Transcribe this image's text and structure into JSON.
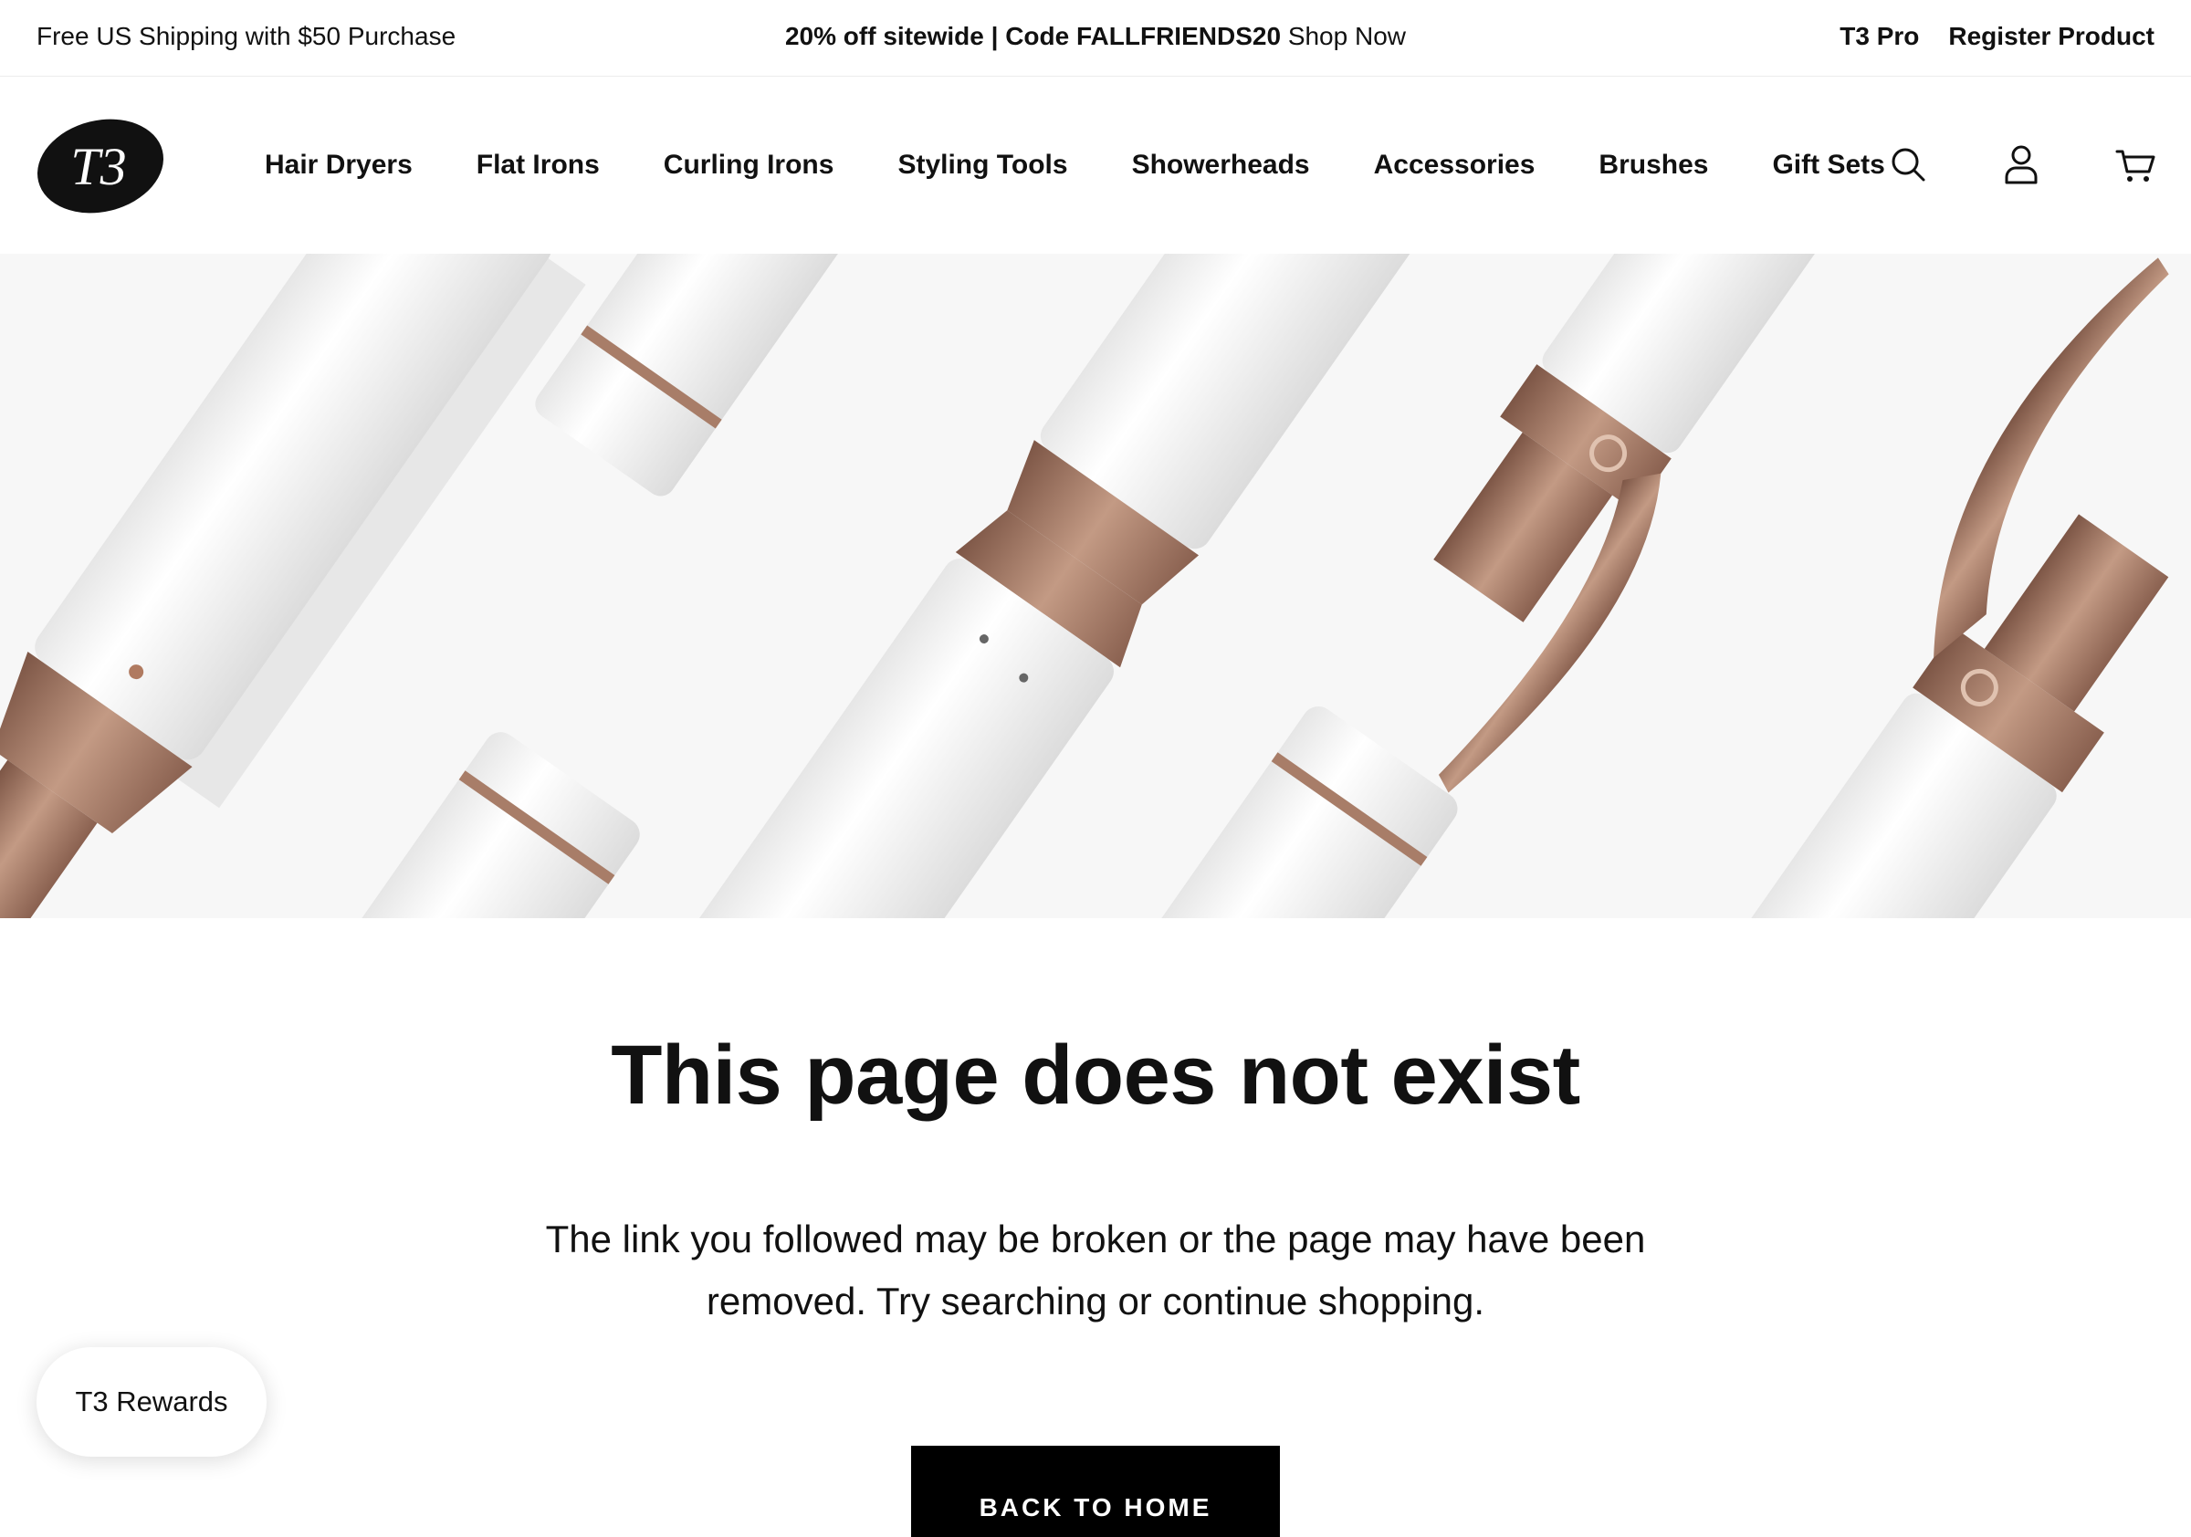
{
  "announcement": {
    "shipping": "Free US Shipping with $50 Purchase",
    "promo_bold": "20% off sitewide | Code FALLFRIENDS20",
    "promo_link": "Shop Now",
    "links": [
      "T3 Pro",
      "Register Product"
    ]
  },
  "header": {
    "logo_text": "T3",
    "nav": [
      "Hair Dryers",
      "Flat Irons",
      "Curling Irons",
      "Styling Tools",
      "Showerheads",
      "Accessories",
      "Brushes",
      "Gift Sets"
    ],
    "icons": [
      "search-icon",
      "account-icon",
      "cart-icon"
    ]
  },
  "colors": {
    "text": "#111111",
    "bronze": "#a87d68",
    "button": "#000000"
  },
  "main": {
    "title": "This page does not exist",
    "body": "The link you followed may be broken or the page may have been removed. Try searching or continue shopping.",
    "button_label": "BACK TO HOME"
  },
  "rewards": {
    "label": "T3 Rewards"
  }
}
